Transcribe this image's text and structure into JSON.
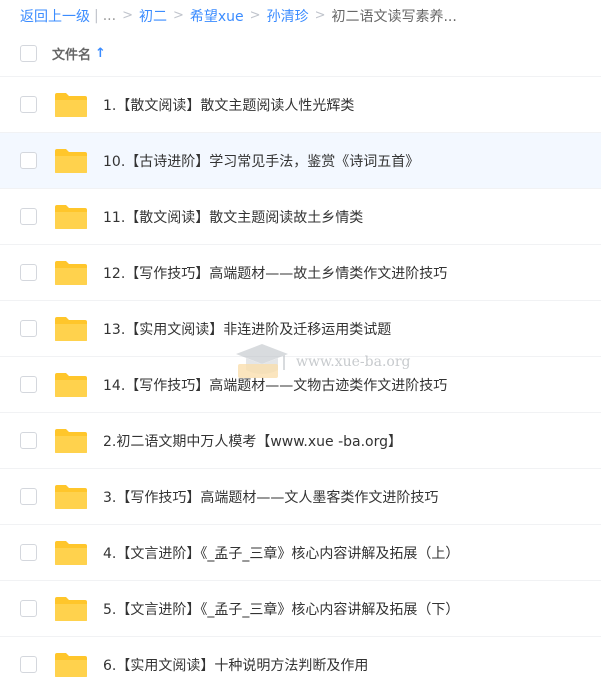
{
  "breadcrumb": {
    "back_label": "返回上一级",
    "ellipsis": "...",
    "items": [
      "初二",
      "希望xue",
      "孙清珍"
    ],
    "current": "初二语文读写素养..."
  },
  "header": {
    "column_label": "文件名",
    "sort_arrow": "↑"
  },
  "files": [
    {
      "name": "1.【散文阅读】散文主题阅读人性光辉类"
    },
    {
      "name": "10.【古诗进阶】学习常见手法，鉴赏《诗词五首》"
    },
    {
      "name": "11.【散文阅读】散文主题阅读故土乡情类"
    },
    {
      "name": "12.【写作技巧】高端题材——故土乡情类作文进阶技巧"
    },
    {
      "name": "13.【实用文阅读】非连进阶及迁移运用类试题"
    },
    {
      "name": "14.【写作技巧】高端题材——文物古迹类作文进阶技巧"
    },
    {
      "name": "2.初二语文期中万人模考【www.xue -ba.org】"
    },
    {
      "name": "3.【写作技巧】高端题材——文人墨客类作文进阶技巧"
    },
    {
      "name": "4.【文言进阶】《_孟子_三章》核心内容讲解及拓展（上）"
    },
    {
      "name": "5.【文言进阶】《_孟子_三章》核心内容讲解及拓展（下）"
    },
    {
      "name": "6.【实用文阅读】十种说明方法判断及作用"
    }
  ],
  "watermark": {
    "text": "www.xue-ba.org"
  },
  "colors": {
    "accent": "#3b8cff",
    "folder": "#ffc62b",
    "hover_row": "#f3f8ff"
  }
}
